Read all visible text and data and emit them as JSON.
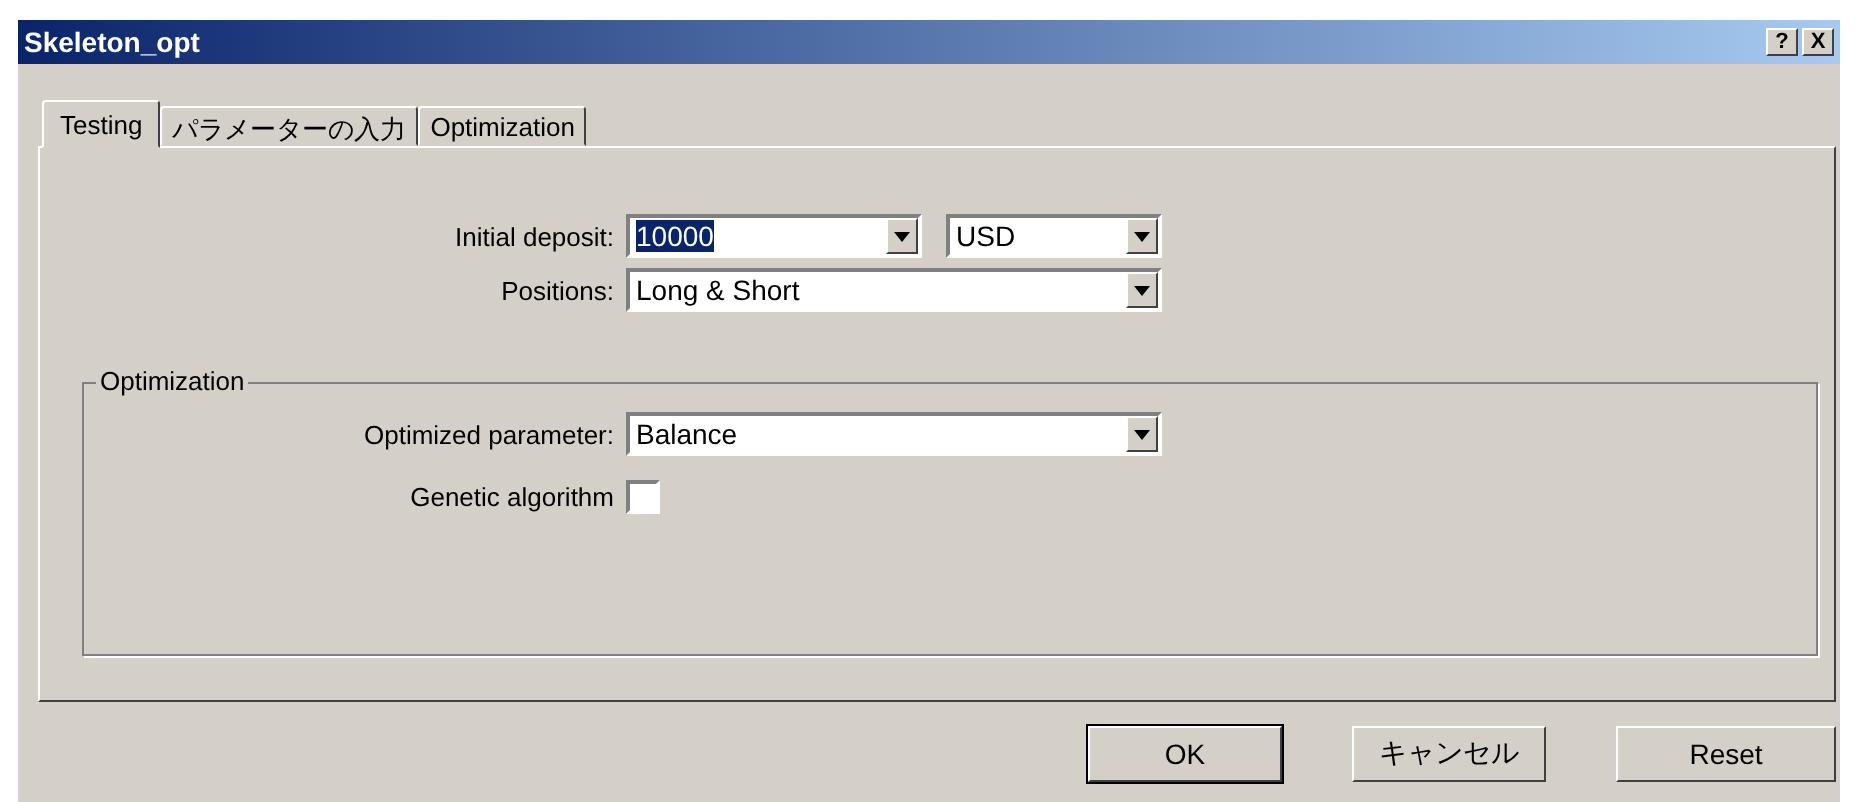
{
  "window": {
    "title": "Skeleton_opt",
    "title_buttons": [
      "?",
      "X"
    ]
  },
  "tabs": [
    {
      "label": "Testing",
      "selected": true
    },
    {
      "label": "パラメーターの入力",
      "selected": false
    },
    {
      "label": "Optimization",
      "selected": false
    }
  ],
  "deposit": {
    "label": "Initial deposit:",
    "value": "10000",
    "highlighted": true,
    "currency": "USD"
  },
  "positions": {
    "label": "Positions:",
    "value": "Long & Short"
  },
  "optimization_group": {
    "title": "Optimization",
    "parameter": {
      "label": "Optimized parameter:",
      "value": "Balance"
    },
    "genetic": {
      "label": "Genetic algorithm",
      "checked": false
    }
  },
  "buttons": [
    {
      "label": "OK",
      "default": true
    },
    {
      "label": "キャンセル",
      "default": false
    },
    {
      "label": "Reset",
      "default": false
    }
  ]
}
